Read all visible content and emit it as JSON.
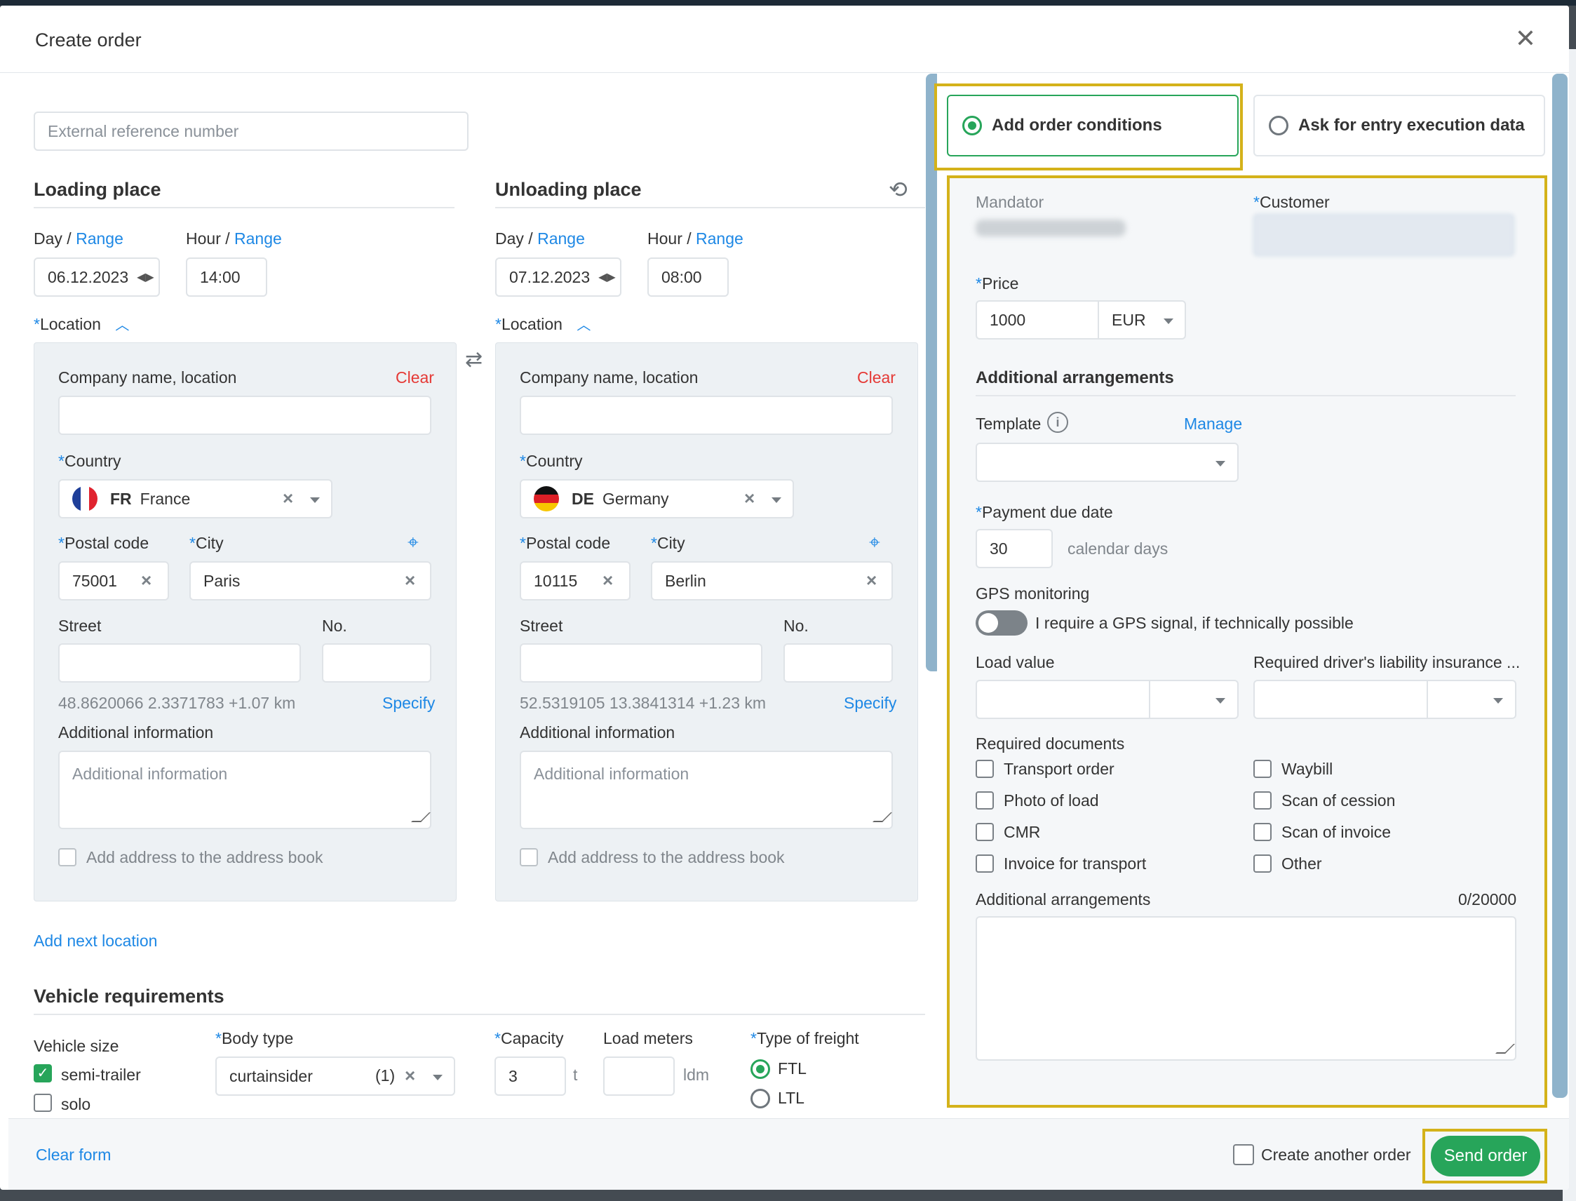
{
  "dialog": {
    "title": "Create order"
  },
  "ext_ref": {
    "placeholder": "External reference number"
  },
  "common": {
    "day": "Day",
    "hour": "Hour",
    "slash": "/",
    "range": "Range",
    "location": "Location",
    "company": "Company name, location",
    "clear": "Clear",
    "country": "Country",
    "postal": "Postal code",
    "city": "City",
    "street": "Street",
    "no": "No.",
    "specify": "Specify",
    "addinfo": "Additional information",
    "addinfo_ph": "Additional information",
    "add_book": "Add address to the address book",
    "required_mark": "*"
  },
  "loading": {
    "title": "Loading place",
    "date": "06.12.2023",
    "hour": "14:00",
    "country_code": "FR",
    "country_name": "France",
    "postal": "75001",
    "city": "Paris",
    "coords": "48.8620066 2.3371783 +1.07 km"
  },
  "unloading": {
    "title": "Unloading place",
    "date": "07.12.2023",
    "hour": "08:00",
    "country_code": "DE",
    "country_name": "Germany",
    "postal": "10115",
    "city": "Berlin",
    "coords": "52.5319105 13.3841314 +1.23 km"
  },
  "add_next": "Add next location",
  "vehicle": {
    "title": "Vehicle requirements",
    "size_label": "Vehicle size",
    "sizes": [
      "semi-trailer",
      "solo"
    ],
    "body_label": "Body type",
    "body_value": "curtainsider",
    "body_count": "(1)",
    "capacity_label": "Capacity",
    "capacity_value": "3",
    "capacity_unit": "t",
    "ldm_label": "Load meters",
    "ldm_unit": "ldm",
    "freight_label": "Type of freight",
    "freight_options": [
      "FTL",
      "LTL"
    ]
  },
  "tabs": {
    "conditions": "Add order conditions",
    "entry": "Ask for entry execution data"
  },
  "conditions": {
    "mandator": "Mandator",
    "customer": "Customer",
    "price_label": "Price",
    "price": "1000",
    "currency": "EUR",
    "arrangements_title": "Additional arrangements",
    "template": "Template",
    "manage": "Manage",
    "payment_label": "Payment due date",
    "payment": "30",
    "payment_unit": "calendar days",
    "gps_label": "GPS monitoring",
    "gps_text": "I require a GPS signal, if technically possible",
    "load_value": "Load value",
    "insurance": "Required driver's liability insurance ...",
    "docs_label": "Required documents",
    "docs": [
      "Transport order",
      "Waybill",
      "Photo of load",
      "Scan of cession",
      "CMR",
      "Scan of invoice",
      "Invoice for transport",
      "Other"
    ],
    "arr_label": "Additional arrangements",
    "arr_count": "0/20000"
  },
  "footer": {
    "clear": "Clear form",
    "another": "Create another order",
    "send": "Send order"
  },
  "colors": {
    "accent": "#1e88e5",
    "success": "#27a55a",
    "danger": "#e53935",
    "highlight": "#d4b21a"
  }
}
